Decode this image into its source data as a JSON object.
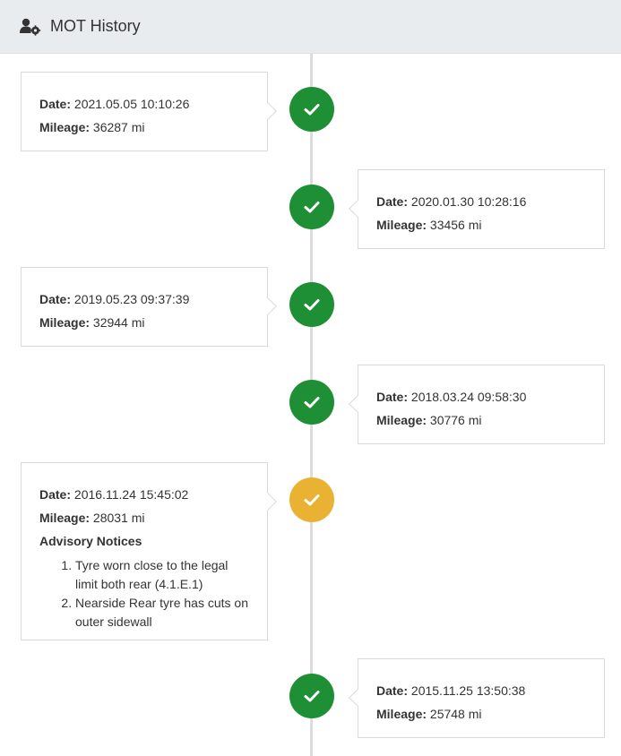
{
  "header": {
    "title": "MOT History",
    "icon": "user-cog-icon"
  },
  "colors": {
    "pass": "#1f8f35",
    "advisory": "#eab233",
    "header_bg": "#e9ecef",
    "line": "#dcdcdc"
  },
  "labels": {
    "date": "Date:",
    "mileage": "Mileage:",
    "advisory_title": "Advisory Notices"
  },
  "entries": [
    {
      "date": "2021.05.05 10:10:26",
      "mileage": "36287 mi",
      "status": "pass"
    },
    {
      "date": "2020.01.30 10:28:16",
      "mileage": "33456 mi",
      "status": "pass"
    },
    {
      "date": "2019.05.23 09:37:39",
      "mileage": "32944 mi",
      "status": "pass"
    },
    {
      "date": "2018.03.24 09:58:30",
      "mileage": "30776 mi",
      "status": "pass"
    },
    {
      "date": "2016.11.24 15:45:02",
      "mileage": "28031 mi",
      "status": "advisory",
      "advisories": [
        "Tyre worn close to the legal limit both rear (4.1.E.1)",
        "Nearside Rear tyre has cuts on outer sidewall"
      ]
    },
    {
      "date": "2015.11.25 13:50:38",
      "mileage": "25748 mi",
      "status": "pass"
    }
  ]
}
